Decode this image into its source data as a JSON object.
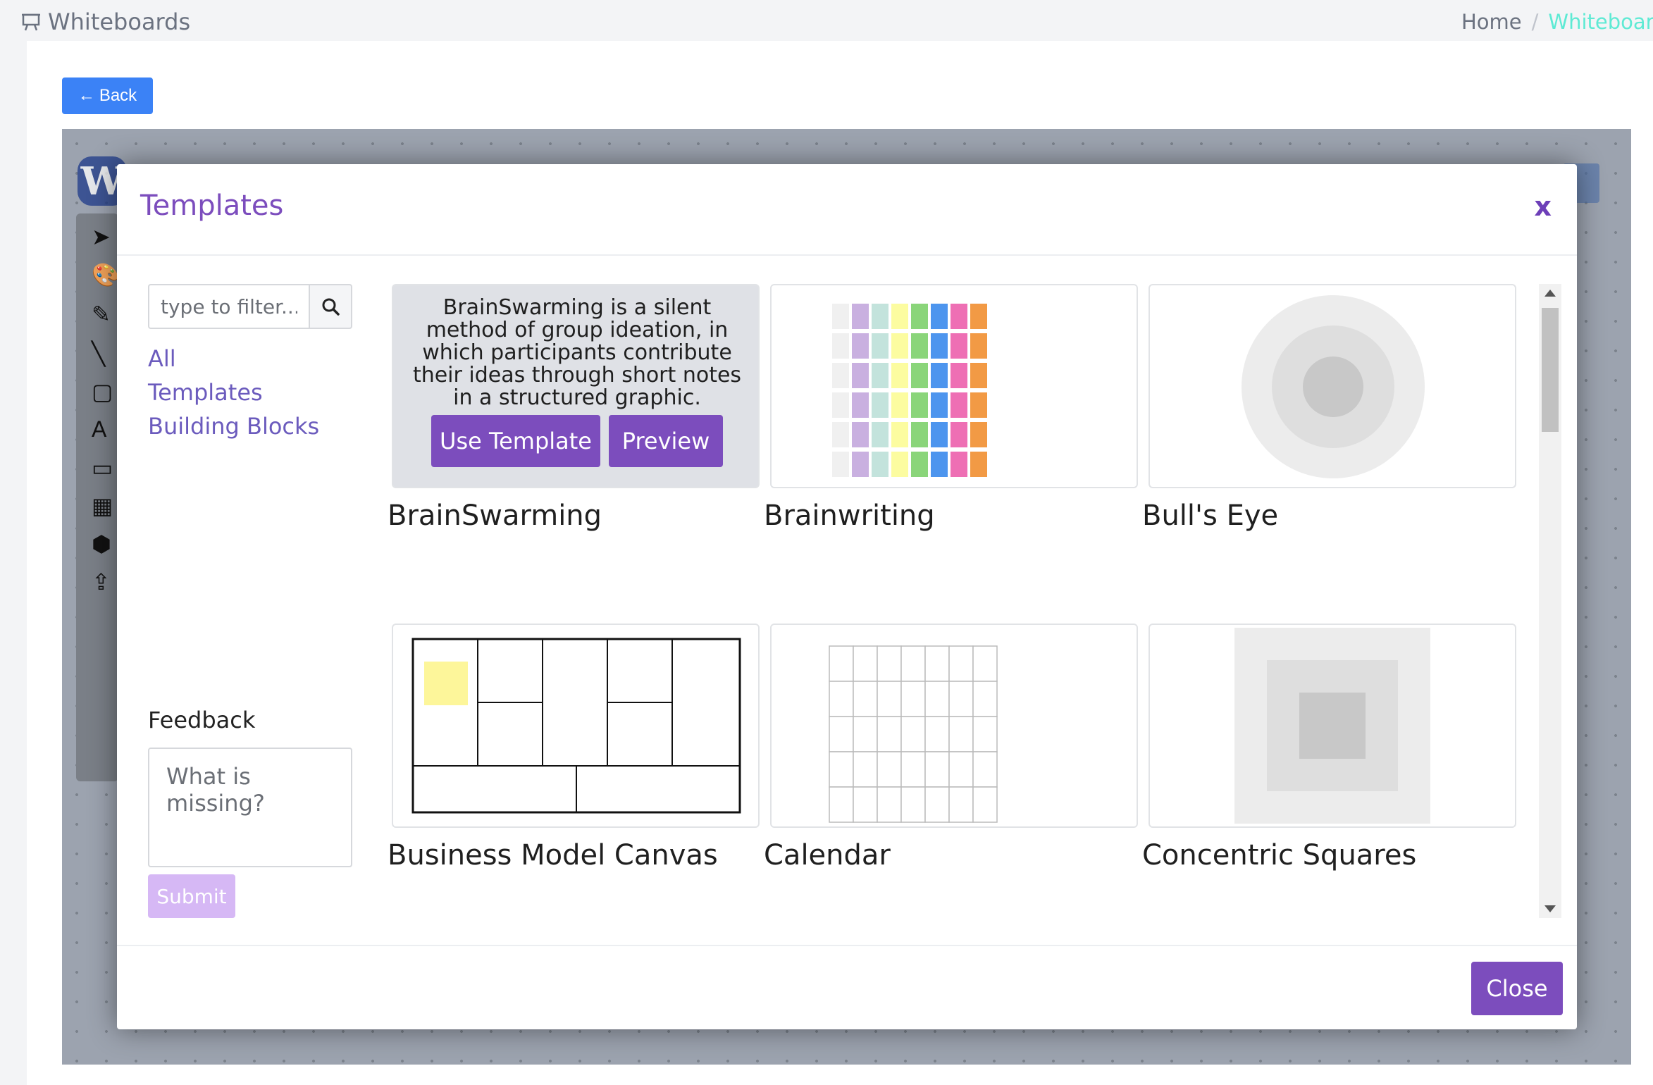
{
  "header": {
    "title": "Whiteboards",
    "breadcrumb": [
      "Home",
      "Whiteboards"
    ]
  },
  "back_label": "Back",
  "modal": {
    "title": "Templates",
    "close_x": "x",
    "filter_placeholder": "type to filter...",
    "categories": [
      "All",
      "Templates",
      "Building Blocks"
    ],
    "feedback_label": "Feedback",
    "feedback_placeholder": "What is missing?",
    "submit_label": "Submit",
    "close_label": "Close",
    "templates": [
      {
        "name": "BrainSwarming",
        "description": "BrainSwarming is a silent method of group ideation, in which participants contribute their ideas through short notes in a structured graphic.",
        "use_label": "Use Template",
        "preview_label": "Preview"
      },
      {
        "name": "Brainwriting"
      },
      {
        "name": "Bull's Eye"
      },
      {
        "name": "Business Model Canvas"
      },
      {
        "name": "Calendar"
      },
      {
        "name": "Concentric Squares"
      }
    ]
  },
  "colors": {
    "accent": "#7c4dbd",
    "primary_blue": "#3b82f6",
    "breadcrumb_active": "#5eead4"
  }
}
